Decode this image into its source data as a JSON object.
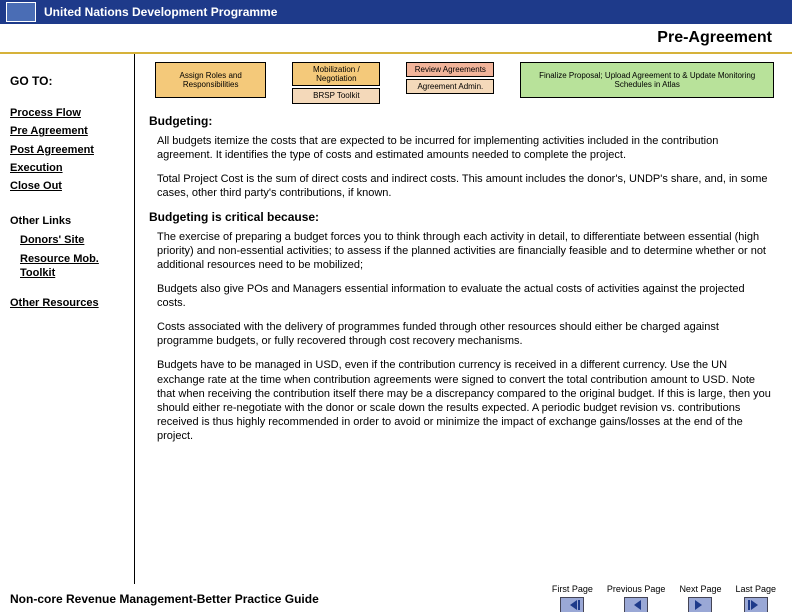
{
  "header": {
    "org": "United Nations Development Programme"
  },
  "page_title": "Pre-Agreement",
  "sidebar": {
    "goto_label": "GO TO:",
    "links": [
      "Process Flow",
      "Pre Agreement",
      "Post Agreement",
      "Execution",
      "Close Out"
    ],
    "other_links_label": "Other Links",
    "sublinks": [
      "Donors' Site",
      "Resource Mob. Toolkit"
    ],
    "other_resources": "Other Resources"
  },
  "flow": {
    "col1": {
      "top": "Assign Roles and Responsibilities"
    },
    "col2": {
      "top": "Mobilization / Negotiation",
      "bottom": "BRSP Toolkit"
    },
    "col3": {
      "top": "Review Agreements",
      "bottom": "Agreement Admin."
    },
    "col4": {
      "top": "Finalize Proposal; Upload Agreement to & Update Monitoring Schedules in Atlas"
    }
  },
  "body": {
    "heading": "Budgeting:",
    "p1": "All budgets itemize the costs that are expected to be incurred for implementing activities included in the contribution agreement. It identifies the type of costs and estimated amounts needed to complete the project.",
    "p2": "Total Project Cost is the sum of direct costs and indirect costs. This amount includes the donor's, UNDP's share, and, in some cases, other third party's contributions, if known.",
    "subheading": "Budgeting is critical because:",
    "p3": "The exercise of preparing a budget forces you to think through each activity in detail, to differentiate between essential (high priority) and non-essential activities; to assess if the planned activities are financially feasible and to determine whether or not additional resources need to be mobilized;",
    "p4": "Budgets also give POs and Managers essential information to evaluate the actual costs of activities against the projected costs.",
    "p5": "Costs associated with the delivery of programmes funded through other resources should either be charged against programme budgets, or fully recovered through cost recovery mechanisms.",
    "p6": "Budgets have to be managed in USD, even if the contribution currency is received in a different currency. Use the UN exchange rate at the time when contribution agreements were signed to convert the total contribution amount to USD. Note that when receiving the contribution itself there may be a discrepancy compared to the original budget. If this is large, then you should either re-negotiate with the donor or scale down the results expected. A periodic budget revision vs. contributions received is thus highly recommended in order to avoid or minimize the impact of exchange gains/losses at the end of the project."
  },
  "footer": {
    "doc_title": "Non-core Revenue Management-Better Practice Guide",
    "nav": {
      "first": "First Page",
      "prev": "Previous Page",
      "next": "Next Page",
      "last": "Last Page"
    }
  }
}
